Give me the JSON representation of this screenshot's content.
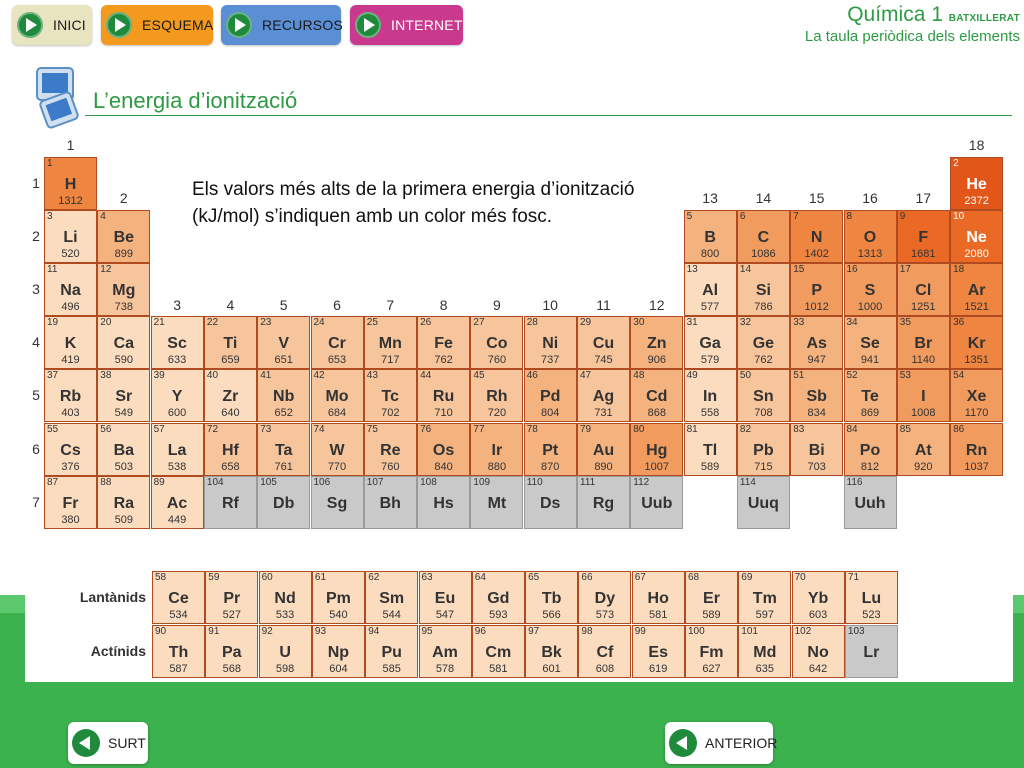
{
  "nav": [
    {
      "id": "inici",
      "label": "INICI",
      "color": "#e8e4c0",
      "light": false
    },
    {
      "id": "esquema",
      "label": "ESQUEMA",
      "color": "#f39a1e",
      "light": false
    },
    {
      "id": "recursos",
      "label": "RECURSOS",
      "color": "#5a8fd6",
      "light": false
    },
    {
      "id": "internet",
      "label": "INTERNET",
      "color": "#c93a8f",
      "light": true
    }
  ],
  "header": {
    "course": "Química 1",
    "level": "BATXILLERAT",
    "subtitle": "La taula periòdica dels elements"
  },
  "section": {
    "title": "L’energia d’ionització"
  },
  "info_text": "Els valors més alts de la primera energia d’ionització (kJ/mol) s’indiquen amb un color més fosc.",
  "table": {
    "groups": [
      "1",
      "2",
      "3",
      "4",
      "5",
      "6",
      "7",
      "8",
      "9",
      "10",
      "11",
      "12",
      "13",
      "14",
      "15",
      "16",
      "17",
      "18"
    ],
    "periods": [
      "1",
      "2",
      "3",
      "4",
      "5",
      "6",
      "7"
    ],
    "lanthanides_label": "Lantànids",
    "actinides_label": "Actínids",
    "elements": [
      {
        "n": "1",
        "s": "H",
        "ie": "1312",
        "g": 1,
        "p": 1
      },
      {
        "n": "2",
        "s": "He",
        "ie": "2372",
        "g": 18,
        "p": 1
      },
      {
        "n": "3",
        "s": "Li",
        "ie": "520",
        "g": 1,
        "p": 2
      },
      {
        "n": "4",
        "s": "Be",
        "ie": "899",
        "g": 2,
        "p": 2
      },
      {
        "n": "5",
        "s": "B",
        "ie": "800",
        "g": 13,
        "p": 2
      },
      {
        "n": "6",
        "s": "C",
        "ie": "1086",
        "g": 14,
        "p": 2
      },
      {
        "n": "7",
        "s": "N",
        "ie": "1402",
        "g": 15,
        "p": 2
      },
      {
        "n": "8",
        "s": "O",
        "ie": "1313",
        "g": 16,
        "p": 2
      },
      {
        "n": "9",
        "s": "F",
        "ie": "1681",
        "g": 17,
        "p": 2
      },
      {
        "n": "10",
        "s": "Ne",
        "ie": "2080",
        "g": 18,
        "p": 2
      },
      {
        "n": "11",
        "s": "Na",
        "ie": "496",
        "g": 1,
        "p": 3
      },
      {
        "n": "12",
        "s": "Mg",
        "ie": "738",
        "g": 2,
        "p": 3
      },
      {
        "n": "13",
        "s": "Al",
        "ie": "577",
        "g": 13,
        "p": 3
      },
      {
        "n": "14",
        "s": "Si",
        "ie": "786",
        "g": 14,
        "p": 3
      },
      {
        "n": "15",
        "s": "P",
        "ie": "1012",
        "g": 15,
        "p": 3
      },
      {
        "n": "16",
        "s": "S",
        "ie": "1000",
        "g": 16,
        "p": 3
      },
      {
        "n": "17",
        "s": "Cl",
        "ie": "1251",
        "g": 17,
        "p": 3
      },
      {
        "n": "18",
        "s": "Ar",
        "ie": "1521",
        "g": 18,
        "p": 3
      },
      {
        "n": "19",
        "s": "K",
        "ie": "419",
        "g": 1,
        "p": 4
      },
      {
        "n": "20",
        "s": "Ca",
        "ie": "590",
        "g": 2,
        "p": 4
      },
      {
        "n": "21",
        "s": "Sc",
        "ie": "633",
        "g": 3,
        "p": 4
      },
      {
        "n": "22",
        "s": "Ti",
        "ie": "659",
        "g": 4,
        "p": 4
      },
      {
        "n": "23",
        "s": "V",
        "ie": "651",
        "g": 5,
        "p": 4
      },
      {
        "n": "24",
        "s": "Cr",
        "ie": "653",
        "g": 6,
        "p": 4
      },
      {
        "n": "25",
        "s": "Mn",
        "ie": "717",
        "g": 7,
        "p": 4
      },
      {
        "n": "26",
        "s": "Fe",
        "ie": "762",
        "g": 8,
        "p": 4
      },
      {
        "n": "27",
        "s": "Co",
        "ie": "760",
        "g": 9,
        "p": 4
      },
      {
        "n": "28",
        "s": "Ni",
        "ie": "737",
        "g": 10,
        "p": 4
      },
      {
        "n": "29",
        "s": "Cu",
        "ie": "745",
        "g": 11,
        "p": 4
      },
      {
        "n": "30",
        "s": "Zn",
        "ie": "906",
        "g": 12,
        "p": 4
      },
      {
        "n": "31",
        "s": "Ga",
        "ie": "579",
        "g": 13,
        "p": 4
      },
      {
        "n": "32",
        "s": "Ge",
        "ie": "762",
        "g": 14,
        "p": 4
      },
      {
        "n": "33",
        "s": "As",
        "ie": "947",
        "g": 15,
        "p": 4
      },
      {
        "n": "34",
        "s": "Se",
        "ie": "941",
        "g": 16,
        "p": 4
      },
      {
        "n": "35",
        "s": "Br",
        "ie": "1140",
        "g": 17,
        "p": 4
      },
      {
        "n": "36",
        "s": "Kr",
        "ie": "1351",
        "g": 18,
        "p": 4
      },
      {
        "n": "37",
        "s": "Rb",
        "ie": "403",
        "g": 1,
        "p": 5
      },
      {
        "n": "38",
        "s": "Sr",
        "ie": "549",
        "g": 2,
        "p": 5
      },
      {
        "n": "39",
        "s": "Y",
        "ie": "600",
        "g": 3,
        "p": 5
      },
      {
        "n": "40",
        "s": "Zr",
        "ie": "640",
        "g": 4,
        "p": 5
      },
      {
        "n": "41",
        "s": "Nb",
        "ie": "652",
        "g": 5,
        "p": 5
      },
      {
        "n": "42",
        "s": "Mo",
        "ie": "684",
        "g": 6,
        "p": 5
      },
      {
        "n": "43",
        "s": "Tc",
        "ie": "702",
        "g": 7,
        "p": 5
      },
      {
        "n": "44",
        "s": "Ru",
        "ie": "710",
        "g": 8,
        "p": 5
      },
      {
        "n": "45",
        "s": "Rh",
        "ie": "720",
        "g": 9,
        "p": 5
      },
      {
        "n": "46",
        "s": "Pd",
        "ie": "804",
        "g": 10,
        "p": 5
      },
      {
        "n": "47",
        "s": "Ag",
        "ie": "731",
        "g": 11,
        "p": 5
      },
      {
        "n": "48",
        "s": "Cd",
        "ie": "868",
        "g": 12,
        "p": 5
      },
      {
        "n": "49",
        "s": "In",
        "ie": "558",
        "g": 13,
        "p": 5
      },
      {
        "n": "50",
        "s": "Sn",
        "ie": "708",
        "g": 14,
        "p": 5
      },
      {
        "n": "51",
        "s": "Sb",
        "ie": "834",
        "g": 15,
        "p": 5
      },
      {
        "n": "52",
        "s": "Te",
        "ie": "869",
        "g": 16,
        "p": 5
      },
      {
        "n": "53",
        "s": "I",
        "ie": "1008",
        "g": 17,
        "p": 5
      },
      {
        "n": "54",
        "s": "Xe",
        "ie": "1170",
        "g": 18,
        "p": 5
      },
      {
        "n": "55",
        "s": "Cs",
        "ie": "376",
        "g": 1,
        "p": 6
      },
      {
        "n": "56",
        "s": "Ba",
        "ie": "503",
        "g": 2,
        "p": 6
      },
      {
        "n": "57",
        "s": "La",
        "ie": "538",
        "g": 3,
        "p": 6
      },
      {
        "n": "72",
        "s": "Hf",
        "ie": "658",
        "g": 4,
        "p": 6
      },
      {
        "n": "73",
        "s": "Ta",
        "ie": "761",
        "g": 5,
        "p": 6
      },
      {
        "n": "74",
        "s": "W",
        "ie": "770",
        "g": 6,
        "p": 6
      },
      {
        "n": "75",
        "s": "Re",
        "ie": "760",
        "g": 7,
        "p": 6
      },
      {
        "n": "76",
        "s": "Os",
        "ie": "840",
        "g": 8,
        "p": 6
      },
      {
        "n": "77",
        "s": "Ir",
        "ie": "880",
        "g": 9,
        "p": 6
      },
      {
        "n": "78",
        "s": "Pt",
        "ie": "870",
        "g": 10,
        "p": 6
      },
      {
        "n": "79",
        "s": "Au",
        "ie": "890",
        "g": 11,
        "p": 6
      },
      {
        "n": "80",
        "s": "Hg",
        "ie": "1007",
        "g": 12,
        "p": 6
      },
      {
        "n": "81",
        "s": "Tl",
        "ie": "589",
        "g": 13,
        "p": 6
      },
      {
        "n": "82",
        "s": "Pb",
        "ie": "715",
        "g": 14,
        "p": 6
      },
      {
        "n": "83",
        "s": "Bi",
        "ie": "703",
        "g": 15,
        "p": 6
      },
      {
        "n": "84",
        "s": "Po",
        "ie": "812",
        "g": 16,
        "p": 6
      },
      {
        "n": "85",
        "s": "At",
        "ie": "920",
        "g": 17,
        "p": 6
      },
      {
        "n": "86",
        "s": "Rn",
        "ie": "1037",
        "g": 18,
        "p": 6
      },
      {
        "n": "87",
        "s": "Fr",
        "ie": "380",
        "g": 1,
        "p": 7
      },
      {
        "n": "88",
        "s": "Ra",
        "ie": "509",
        "g": 2,
        "p": 7
      },
      {
        "n": "89",
        "s": "Ac",
        "ie": "449",
        "g": 3,
        "p": 7
      },
      {
        "n": "104",
        "s": "Rf",
        "ie": "",
        "g": 4,
        "p": 7
      },
      {
        "n": "105",
        "s": "Db",
        "ie": "",
        "g": 5,
        "p": 7
      },
      {
        "n": "106",
        "s": "Sg",
        "ie": "",
        "g": 6,
        "p": 7
      },
      {
        "n": "107",
        "s": "Bh",
        "ie": "",
        "g": 7,
        "p": 7
      },
      {
        "n": "108",
        "s": "Hs",
        "ie": "",
        "g": 8,
        "p": 7
      },
      {
        "n": "109",
        "s": "Mt",
        "ie": "",
        "g": 9,
        "p": 7
      },
      {
        "n": "110",
        "s": "Ds",
        "ie": "",
        "g": 10,
        "p": 7
      },
      {
        "n": "111",
        "s": "Rg",
        "ie": "",
        "g": 11,
        "p": 7
      },
      {
        "n": "112",
        "s": "Uub",
        "ie": "",
        "g": 12,
        "p": 7
      },
      {
        "n": "114",
        "s": "Uuq",
        "ie": "",
        "g": 14,
        "p": 7
      },
      {
        "n": "116",
        "s": "Uuh",
        "ie": "",
        "g": 16,
        "p": 7
      }
    ],
    "lanthanides": [
      {
        "n": "58",
        "s": "Ce",
        "ie": "534"
      },
      {
        "n": "59",
        "s": "Pr",
        "ie": "527"
      },
      {
        "n": "60",
        "s": "Nd",
        "ie": "533"
      },
      {
        "n": "61",
        "s": "Pm",
        "ie": "540"
      },
      {
        "n": "62",
        "s": "Sm",
        "ie": "544"
      },
      {
        "n": "63",
        "s": "Eu",
        "ie": "547"
      },
      {
        "n": "64",
        "s": "Gd",
        "ie": "593"
      },
      {
        "n": "65",
        "s": "Tb",
        "ie": "566"
      },
      {
        "n": "66",
        "s": "Dy",
        "ie": "573"
      },
      {
        "n": "67",
        "s": "Ho",
        "ie": "581"
      },
      {
        "n": "68",
        "s": "Er",
        "ie": "589"
      },
      {
        "n": "69",
        "s": "Tm",
        "ie": "597"
      },
      {
        "n": "70",
        "s": "Yb",
        "ie": "603"
      },
      {
        "n": "71",
        "s": "Lu",
        "ie": "523"
      }
    ],
    "actinides": [
      {
        "n": "90",
        "s": "Th",
        "ie": "587"
      },
      {
        "n": "91",
        "s": "Pa",
        "ie": "568"
      },
      {
        "n": "92",
        "s": "U",
        "ie": "598"
      },
      {
        "n": "93",
        "s": "Np",
        "ie": "604"
      },
      {
        "n": "94",
        "s": "Pu",
        "ie": "585"
      },
      {
        "n": "95",
        "s": "Am",
        "ie": "578"
      },
      {
        "n": "96",
        "s": "Cm",
        "ie": "581"
      },
      {
        "n": "97",
        "s": "Bk",
        "ie": "601"
      },
      {
        "n": "98",
        "s": "Cf",
        "ie": "608"
      },
      {
        "n": "99",
        "s": "Es",
        "ie": "619"
      },
      {
        "n": "100",
        "s": "Fm",
        "ie": "627"
      },
      {
        "n": "101",
        "s": "Md",
        "ie": "635"
      },
      {
        "n": "102",
        "s": "No",
        "ie": "642"
      },
      {
        "n": "103",
        "s": "Lr",
        "ie": ""
      }
    ]
  },
  "footer": {
    "exit_label": "SURT",
    "back_label": "ANTERIOR"
  },
  "colors": {
    "green": "#2e9a44",
    "green_bg": "#3fbf5a",
    "unknown": "#c9c9c9"
  }
}
